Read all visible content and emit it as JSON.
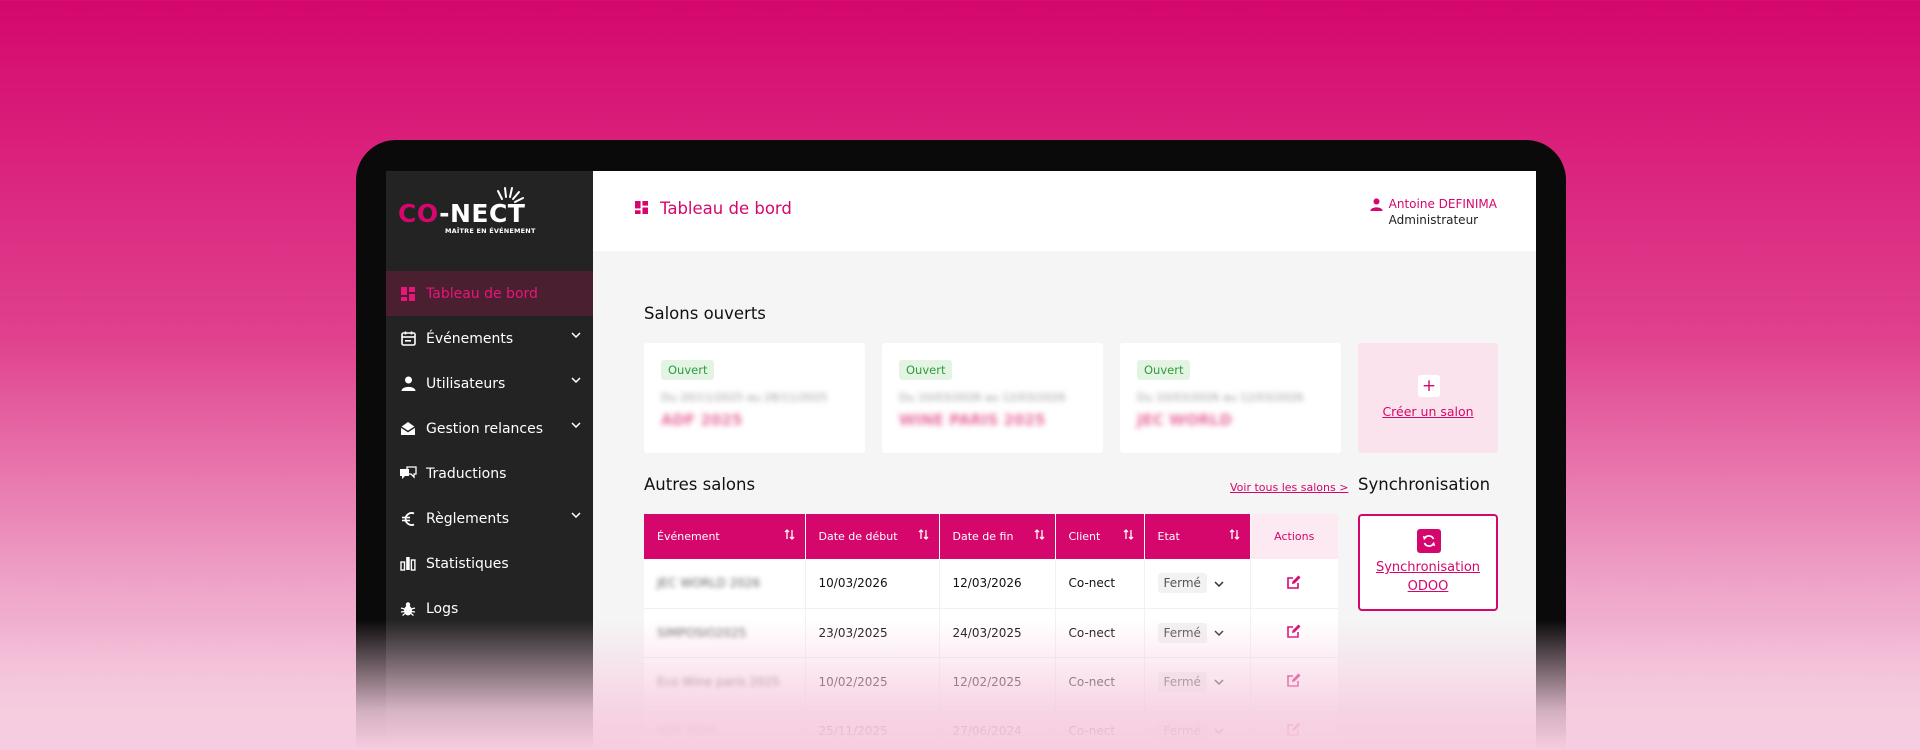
{
  "brand": {
    "logo_main_co": "CO",
    "logo_main_rest": "-NECT",
    "logo_tagline": "MAÎTRE EN ÉVÉNEMENT",
    "accent": "#d5076c"
  },
  "sidebar": {
    "items": [
      {
        "label": "Tableau de bord",
        "icon": "dashboard-icon",
        "active": true
      },
      {
        "label": "Événements",
        "icon": "calendar-icon",
        "expandable": true
      },
      {
        "label": "Utilisateurs",
        "icon": "user-icon",
        "expandable": true
      },
      {
        "label": "Gestion relances",
        "icon": "mail-open-icon",
        "expandable": true
      },
      {
        "label": "Traductions",
        "icon": "translate-icon"
      },
      {
        "label": "Règlements",
        "icon": "euro-icon",
        "expandable": true
      },
      {
        "label": "Statistiques",
        "icon": "bar-chart-icon"
      },
      {
        "label": "Logs",
        "icon": "bug-icon"
      }
    ]
  },
  "header": {
    "title": "Tableau de bord",
    "user_name": "Antoine DEFINIMA",
    "user_role": "Administrateur"
  },
  "open_fairs": {
    "heading": "Salons ouverts",
    "cards": [
      {
        "status": "Ouvert",
        "dates": "Du 20/11/2025 au 28/11/2025",
        "name": "ADF 2025"
      },
      {
        "status": "Ouvert",
        "dates": "Du 10/03/2026 au 12/03/2026",
        "name": "WINE PARIS 2025"
      },
      {
        "status": "Ouvert",
        "dates": "Du 10/03/2026 au 12/03/2026",
        "name": "JEC WORLD"
      }
    ],
    "create_label": "Créer un salon"
  },
  "other_fairs": {
    "heading": "Autres salons",
    "see_all": "Voir tous les salons >",
    "columns": [
      "Événement",
      "Date de début",
      "Date de fin",
      "Client",
      "Etat",
      "Actions"
    ],
    "rows": [
      {
        "event": "JEC WORLD 2026",
        "start": "10/03/2026",
        "end": "12/03/2026",
        "client": "Co-nect",
        "state": "Fermé"
      },
      {
        "event": "SIMPOSIO2025",
        "start": "23/03/2025",
        "end": "24/03/2025",
        "client": "Co-nect",
        "state": "Fermé"
      },
      {
        "event": "Eco Wine paris 2025",
        "start": "10/02/2025",
        "end": "12/02/2025",
        "client": "Co-nect",
        "state": "Fermé"
      },
      {
        "event": "ADF 2024",
        "start": "25/11/2025",
        "end": "27/06/2024",
        "client": "Co-nect",
        "state": "Fermé"
      }
    ]
  },
  "sync": {
    "heading": "Synchronisation",
    "label_line1": "Synchronisation",
    "label_line2": "ODOO"
  }
}
